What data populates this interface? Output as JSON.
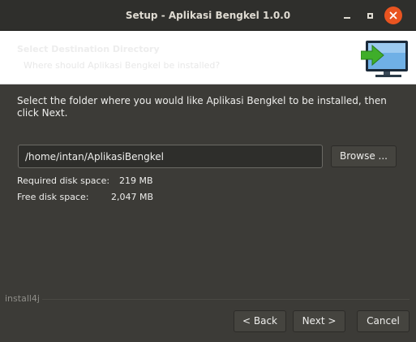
{
  "window": {
    "title": "Setup - Aplikasi Bengkel 1.0.0",
    "close_color": "#e95420"
  },
  "header": {
    "title": "Select Destination Directory",
    "subtitle": "Where should Aplikasi Bengkel be installed?",
    "icon": "install-computer-icon"
  },
  "main": {
    "instruction": "Select the folder where you would like Aplikasi Bengkel to be installed, then click Next.",
    "path_value": "/home/intan/AplikasiBengkel",
    "browse_label": "Browse ...",
    "required_label": "Required disk space:",
    "required_value": "219 MB",
    "free_label": "Free disk space:",
    "free_value": "2,047 MB"
  },
  "footer": {
    "vendor": "install4j",
    "back_label": "< Back",
    "next_label": "Next >",
    "cancel_label": "Cancel"
  }
}
